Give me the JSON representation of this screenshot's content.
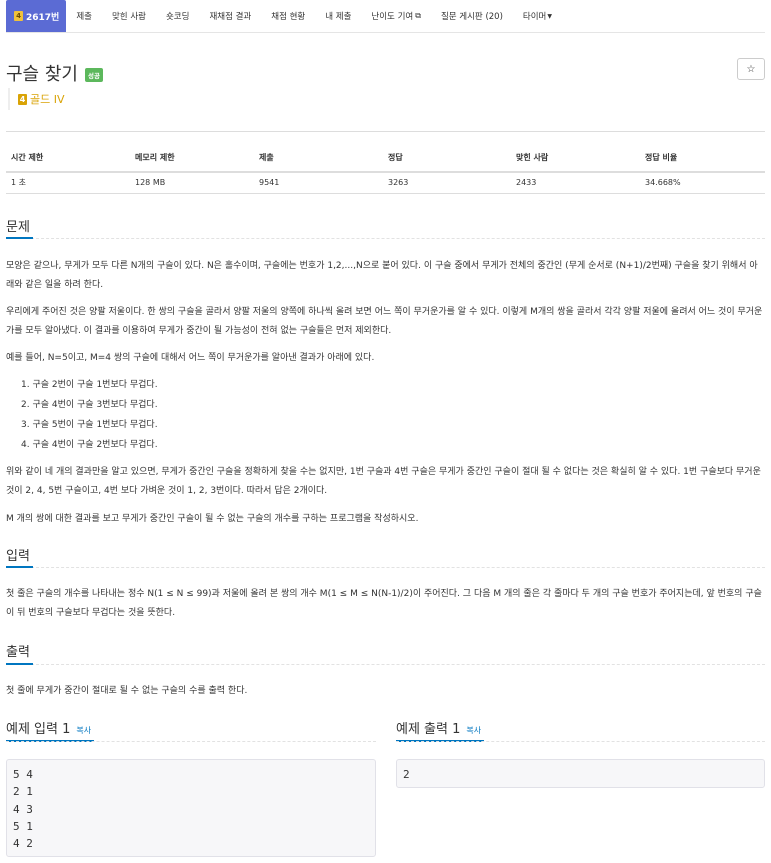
{
  "nav": {
    "problem_id": "2617번",
    "items": [
      {
        "label": "제출"
      },
      {
        "label": "맞힌 사람"
      },
      {
        "label": "숏코딩"
      },
      {
        "label": "재채점 결과"
      },
      {
        "label": "채점 현황"
      },
      {
        "label": "내 제출"
      },
      {
        "label": "난이도 기여"
      },
      {
        "label": "질문 게시판 (20)"
      },
      {
        "label": "타이머"
      }
    ]
  },
  "problem": {
    "title": "구슬 찾기",
    "status_badge": "성공",
    "tier_number": "4",
    "tier": "골드 IV",
    "star": "☆"
  },
  "info": {
    "headers": [
      "시간 제한",
      "메모리 제한",
      "제출",
      "정답",
      "맞힌 사람",
      "정답 비율"
    ],
    "values": [
      "1 초",
      "128 MB",
      "9541",
      "3263",
      "2433",
      "34.668%"
    ]
  },
  "description": {
    "heading": "문제",
    "p1": "모양은 같으나, 무게가 모두 다른 N개의 구슬이 있다. N은 홀수이며, 구슬에는 번호가 1,2,...,N으로 붙어 있다. 이 구슬 중에서 무게가 전체의 중간인 (무게 순서로 (N+1)/2번째) 구슬을 찾기 위해서 아래와 같은 일을 하려 한다.",
    "p2": "우리에게 주어진 것은 양팔 저울이다. 한 쌍의 구슬을 골라서 양팔 저울의 양쪽에 하나씩 올려 보면 어느 쪽이 무거운가를 알 수 있다. 이렇게 M개의 쌍을 골라서 각각 양팔 저울에 올려서 어느 것이 무거운가를 모두 알아냈다. 이 결과를 이용하여 무게가 중간이 될 가능성이 전혀 없는 구슬들은 먼저 제외한다.",
    "p3": "예를 들어, N=5이고, M=4 쌍의 구슬에 대해서 어느 쪽이 무거운가를 알아낸 결과가 아래에 있다.",
    "list": [
      "구슬 2번이 구슬 1번보다 무겁다.",
      "구슬 4번이 구슬 3번보다 무겁다.",
      "구슬 5번이 구슬 1번보다 무겁다.",
      "구슬 4번이 구슬 2번보다 무겁다."
    ],
    "p4": "위와 같이 네 개의 결과만을 알고 있으면, 무게가 중간인 구슬을 정확하게 찾을 수는 없지만, 1번 구슬과 4번 구슬은 무게가 중간인 구슬이 절대 될 수 없다는 것은 확실히 알 수 있다. 1번 구슬보다 무거운 것이 2, 4, 5번 구슬이고, 4번 보다 가벼운 것이 1, 2, 3번이다. 따라서 답은 2개이다.",
    "p5": "M 개의 쌍에 대한 결과를 보고 무게가 중간인 구슬이 될 수 없는 구슬의 개수를 구하는 프로그램을 작성하시오."
  },
  "input": {
    "heading": "입력",
    "text": "첫 줄은 구슬의 개수를 나타내는 정수 N(1 ≤ N ≤ 99)과 저울에 올려 본 쌍의 개수 M(1 ≤ M ≤ N(N-1)/2)이 주어진다. 그 다음 M 개의 줄은 각 줄마다 두 개의 구슬 번호가 주어지는데, 앞 번호의 구슬이 뒤 번호의 구슬보다 무겁다는 것을 뜻한다."
  },
  "output": {
    "heading": "출력",
    "text": "첫 줄에 무게가 중간이 절대로 될 수 없는 구슬의 수를 출력 한다."
  },
  "samples": {
    "input_heading": "예제 입력 1",
    "output_heading": "예제 출력 1",
    "copy_label": "복사",
    "input": "5 4\n2 1\n4 3\n5 1\n4 2",
    "output": "2"
  }
}
